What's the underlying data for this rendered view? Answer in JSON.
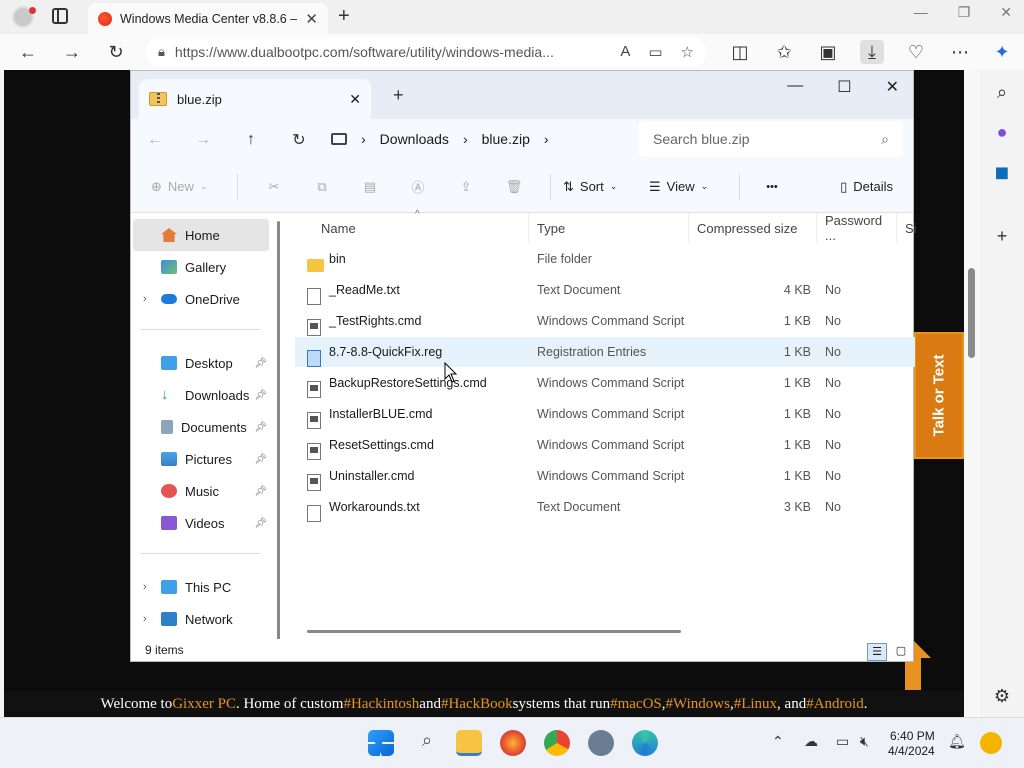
{
  "browser": {
    "tab_title": "Windows Media Center v8.8.6 –",
    "url": "https://www.dualbootpc.com/software/utility/windows-media..."
  },
  "explorer": {
    "tab_title": "blue.zip",
    "breadcrumb": [
      "Downloads",
      "blue.zip"
    ],
    "search_placeholder": "Search blue.zip",
    "commands": {
      "new": "New",
      "sort": "Sort",
      "view": "View",
      "more": "•••",
      "details": "Details"
    },
    "nav_items": [
      {
        "label": "Home",
        "icon": "home-icon",
        "selected": true
      },
      {
        "label": "Gallery",
        "icon": "gallery-icon"
      },
      {
        "label": "OneDrive",
        "icon": "cloud-icon",
        "expandable": true
      },
      {
        "label": "Desktop",
        "icon": "desktop-icon",
        "pinned": true
      },
      {
        "label": "Downloads",
        "icon": "download-icon",
        "pinned": true
      },
      {
        "label": "Documents",
        "icon": "document-icon",
        "pinned": true
      },
      {
        "label": "Pictures",
        "icon": "picture-icon",
        "pinned": true
      },
      {
        "label": "Music",
        "icon": "music-icon",
        "pinned": true
      },
      {
        "label": "Videos",
        "icon": "video-icon",
        "pinned": true
      },
      {
        "label": "This PC",
        "icon": "pc-icon",
        "expandable": true
      },
      {
        "label": "Network",
        "icon": "network-icon",
        "expandable": true
      }
    ],
    "columns": [
      "Name",
      "Type",
      "Compressed size",
      "Password ...",
      "Si"
    ],
    "files": [
      {
        "name": "bin",
        "type": "File folder",
        "size": "",
        "password": "",
        "kind": "folder"
      },
      {
        "name": "_ReadMe.txt",
        "type": "Text Document",
        "size": "4 KB",
        "password": "No",
        "kind": "txt"
      },
      {
        "name": "_TestRights.cmd",
        "type": "Windows Command Script",
        "size": "1 KB",
        "password": "No",
        "kind": "cmd"
      },
      {
        "name": "8.7-8.8-QuickFix.reg",
        "type": "Registration Entries",
        "size": "1 KB",
        "password": "No",
        "kind": "reg"
      },
      {
        "name": "BackupRestoreSettings.cmd",
        "type": "Windows Command Script",
        "size": "1 KB",
        "password": "No",
        "kind": "cmd"
      },
      {
        "name": "InstallerBLUE.cmd",
        "type": "Windows Command Script",
        "size": "1 KB",
        "password": "No",
        "kind": "cmd"
      },
      {
        "name": "ResetSettings.cmd",
        "type": "Windows Command Script",
        "size": "1 KB",
        "password": "No",
        "kind": "cmd"
      },
      {
        "name": "Uninstaller.cmd",
        "type": "Windows Command Script",
        "size": "1 KB",
        "password": "No",
        "kind": "cmd"
      },
      {
        "name": "Workarounds.txt",
        "type": "Text Document",
        "size": "3 KB",
        "password": "No",
        "kind": "txt"
      }
    ],
    "status": "9 items"
  },
  "page": {
    "talk_label": "Talk or Text",
    "marquee": {
      "p1": "Welcome to ",
      "brand": "Gixxer PC",
      "p2": ". Home of custom ",
      "t1": "#Hackintosh",
      "p3": " and ",
      "t2": "#HackBook",
      "p4": " systems that run ",
      "t3": "#macOS",
      "p5": ", ",
      "t4": "#Windows",
      "p6": ", ",
      "t5": "#Linux",
      "p7": ", and ",
      "t6": "#Android",
      "p8": "."
    }
  },
  "taskbar": {
    "time": "6:40 PM",
    "date": "4/4/2024"
  },
  "colors": {
    "accent_orange": "#e8931f",
    "selection_blue": "#e5f1fb"
  }
}
